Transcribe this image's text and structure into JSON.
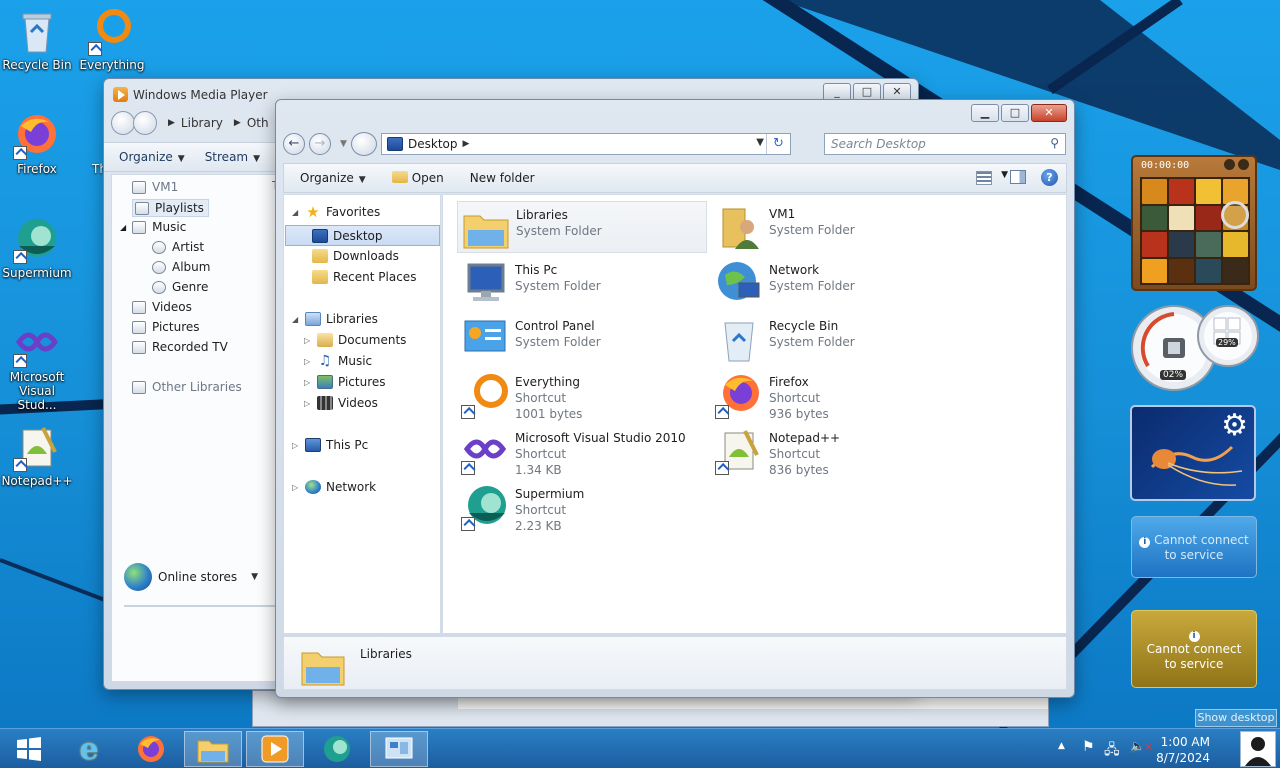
{
  "desktop": {
    "icons": [
      {
        "label": "Recycle Bin"
      },
      {
        "label": "Everything"
      },
      {
        "label": "Firefox"
      },
      {
        "label": "Supermium"
      },
      {
        "label": "Microsoft Visual Stud..."
      },
      {
        "label": "Notepad++"
      }
    ],
    "partial_label": "Th"
  },
  "wmp": {
    "title": "Windows Media Player",
    "crumbs": [
      "Library",
      "Oth"
    ],
    "commands": [
      "Organize",
      "Stream"
    ],
    "column_stub": "T",
    "tree": {
      "vm": "VM1",
      "playlists": "Playlists",
      "music": "Music",
      "artist": "Artist",
      "album": "Album",
      "genre": "Genre",
      "videos": "Videos",
      "pictures": "Pictures",
      "recorded_tv": "Recorded TV",
      "other_libraries": "Other Libraries"
    },
    "online_stores": "Online stores"
  },
  "explorer": {
    "address": "Desktop",
    "search_placeholder": "Search Desktop",
    "commands": {
      "organize": "Organize",
      "open": "Open",
      "new_folder": "New folder"
    },
    "nav": {
      "favorites": "Favorites",
      "desktop": "Desktop",
      "downloads": "Downloads",
      "recent": "Recent Places",
      "libraries": "Libraries",
      "documents": "Documents",
      "music": "Music",
      "pictures": "Pictures",
      "videos": "Videos",
      "this_pc": "This Pc",
      "network": "Network"
    },
    "items": [
      {
        "name": "Libraries",
        "type": "System Folder",
        "size": ""
      },
      {
        "name": "VM1",
        "type": "System Folder",
        "size": ""
      },
      {
        "name": "This Pc",
        "type": "System Folder",
        "size": ""
      },
      {
        "name": "Network",
        "type": "System Folder",
        "size": ""
      },
      {
        "name": "Control Panel",
        "type": "System Folder",
        "size": ""
      },
      {
        "name": "Recycle Bin",
        "type": "System Folder",
        "size": ""
      },
      {
        "name": "Everything",
        "type": "Shortcut",
        "size": "1001 bytes"
      },
      {
        "name": "Firefox",
        "type": "Shortcut",
        "size": "936 bytes"
      },
      {
        "name": "Microsoft Visual Studio 2010",
        "type": "Shortcut",
        "size": "1.34 KB"
      },
      {
        "name": "Notepad++",
        "type": "Shortcut",
        "size": "836 bytes"
      },
      {
        "name": "Supermium",
        "type": "Shortcut",
        "size": "2.23 KB"
      }
    ],
    "details_name": "Libraries"
  },
  "gadgets": {
    "timer": "00:00:00",
    "cpu": "02%",
    "mem": "29%",
    "weather_msg_1": "Cannot connect to service",
    "weather_msg_2": "Cannot connect to service"
  },
  "taskbar": {
    "time": "1:00 AM",
    "date": "8/7/2024",
    "show_desktop": "Show desktop"
  }
}
